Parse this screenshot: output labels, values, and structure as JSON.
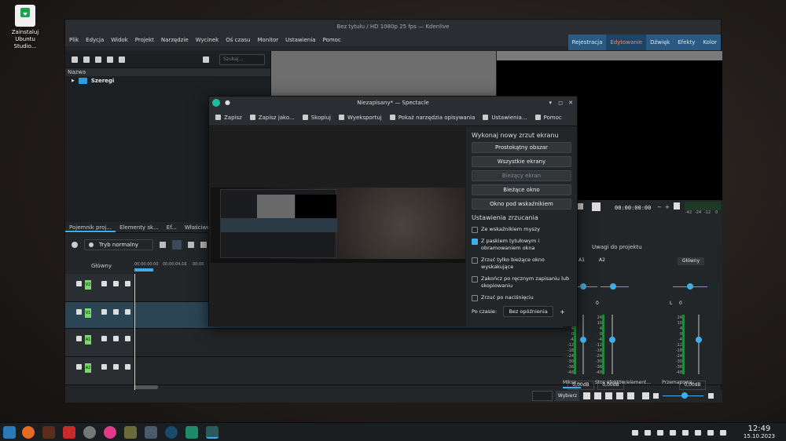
{
  "desktop": {
    "icon_label": "Zainstaluj Ubuntu Studio..."
  },
  "kdenlive": {
    "title": "Bez tytułu / HD 1080p 25 fps — Kdenlive",
    "menu": [
      "Plik",
      "Edycja",
      "Widok",
      "Projekt",
      "Narzędzie",
      "Wycinek",
      "Oś czasu",
      "Monitor",
      "Ustawienia",
      "Pomoc"
    ],
    "workspaces": [
      "Rejestracja",
      "Edytowanie",
      "Dźwięk",
      "Efekty",
      "Kolor"
    ],
    "search_placeholder": "Szukaj...",
    "bin_header": "Nazwa",
    "bin_item": "Szeregi",
    "tabs": [
      "Pojemnik proj...",
      "Elementy sk...",
      "Ef...",
      "Właściwości"
    ],
    "mode": "Tryb normalny",
    "track_header": "Główny",
    "ruler": [
      "00:00:00:00",
      "00:00:04:16",
      "00:00"
    ],
    "tracks": [
      "V2",
      "V1",
      "A1",
      "A2"
    ],
    "monitor_tc": "00:00:00:00",
    "vu_scale": [
      "-42",
      "-24",
      "-12",
      "0"
    ],
    "mixer_tab": "Uwagi do projektu",
    "mixer_channels": [
      "A1",
      "A2",
      "Główny"
    ],
    "pan_value": "0",
    "pan_l": "L",
    "db_value": "0,00dB",
    "db_scale": [
      "24",
      "10",
      "4",
      "0",
      "-4",
      "-12",
      "-18",
      "-24",
      "-30",
      "-36",
      "-48"
    ],
    "bottom_tabs": [
      "Mikse...",
      "Stos efektów/element...",
      "Przemapowa..."
    ],
    "choose": "Wybierz"
  },
  "spectacle": {
    "title": "Niezapisany* — Spectacle",
    "toolbar": [
      "Zapisz",
      "Zapisz jako...",
      "Skopiuj",
      "Wyeksportuj",
      "Pokaż narzędzia opisywania",
      "Ustawienia...",
      "Pomoc"
    ],
    "new_heading": "Wykonaj nowy zrzut ekranu",
    "buttons": [
      "Prostokątny obszar",
      "Wszystkie ekrany",
      "Bieżący ekran",
      "Bieżące okno",
      "Okno pod wskaźnikiem"
    ],
    "settings_heading": "Ustawienia zrzucania",
    "options": [
      {
        "label": "Ze wskaźnikiem myszy",
        "checked": false
      },
      {
        "label": "Z paskiem tytułowym i obramowaniem okna",
        "checked": true
      },
      {
        "label": "Zrzuć tylko bieżące okno wyskakujące",
        "checked": false
      },
      {
        "label": "Zakończ po ręcznym zapisaniu lub skopiowaniu",
        "checked": false
      },
      {
        "label": "Zrzuć po naciśnięciu",
        "checked": false
      }
    ],
    "delay_label": "Po czasie:",
    "delay_value": "Bez opóźnienia"
  },
  "taskbar": {
    "time": "12:49",
    "date": "15.10.2023"
  }
}
